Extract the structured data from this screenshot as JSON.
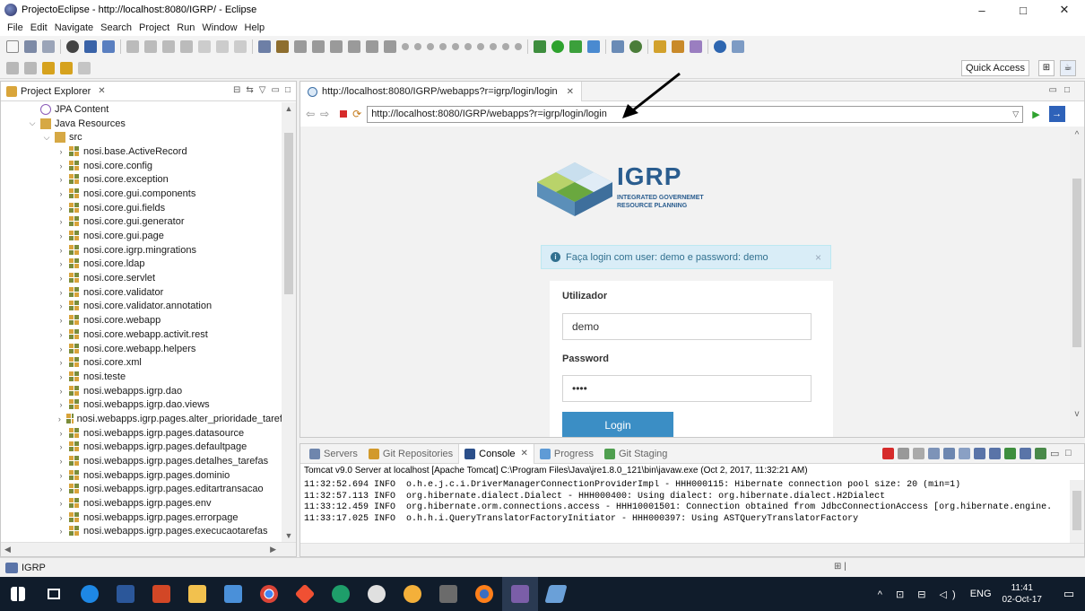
{
  "window": {
    "title": "ProjectoEclipse - http://localhost:8080/IGRP/ - Eclipse",
    "minimize": "–",
    "maximize": "□",
    "close": "✕"
  },
  "menu": [
    "File",
    "Edit",
    "Navigate",
    "Search",
    "Project",
    "Run",
    "Window",
    "Help"
  ],
  "toolbar": {
    "quick_access": "Quick Access"
  },
  "explorer": {
    "title": "Project Explorer",
    "items": [
      {
        "label": "JPA Content",
        "chev": "",
        "indent": 1,
        "icon": "jpa"
      },
      {
        "label": "Java Resources",
        "chev": "v",
        "indent": 1,
        "icon": "folder"
      },
      {
        "label": "src",
        "chev": "v",
        "indent": 2,
        "icon": "folder"
      },
      {
        "label": "nosi.base.ActiveRecord",
        "chev": ">",
        "indent": 3,
        "icon": "pkg"
      },
      {
        "label": "nosi.core.config",
        "chev": ">",
        "indent": 3,
        "icon": "pkg"
      },
      {
        "label": "nosi.core.exception",
        "chev": ">",
        "indent": 3,
        "icon": "pkg"
      },
      {
        "label": "nosi.core.gui.components",
        "chev": ">",
        "indent": 3,
        "icon": "pkg"
      },
      {
        "label": "nosi.core.gui.fields",
        "chev": ">",
        "indent": 3,
        "icon": "pkg"
      },
      {
        "label": "nosi.core.gui.generator",
        "chev": ">",
        "indent": 3,
        "icon": "pkg"
      },
      {
        "label": "nosi.core.gui.page",
        "chev": ">",
        "indent": 3,
        "icon": "pkg"
      },
      {
        "label": "nosi.core.igrp.mingrations",
        "chev": ">",
        "indent": 3,
        "icon": "pkg"
      },
      {
        "label": "nosi.core.ldap",
        "chev": ">",
        "indent": 3,
        "icon": "pkg"
      },
      {
        "label": "nosi.core.servlet",
        "chev": ">",
        "indent": 3,
        "icon": "pkg"
      },
      {
        "label": "nosi.core.validator",
        "chev": ">",
        "indent": 3,
        "icon": "pkg"
      },
      {
        "label": "nosi.core.validator.annotation",
        "chev": ">",
        "indent": 3,
        "icon": "pkg"
      },
      {
        "label": "nosi.core.webapp",
        "chev": ">",
        "indent": 3,
        "icon": "pkg"
      },
      {
        "label": "nosi.core.webapp.activit.rest",
        "chev": ">",
        "indent": 3,
        "icon": "pkg"
      },
      {
        "label": "nosi.core.webapp.helpers",
        "chev": ">",
        "indent": 3,
        "icon": "pkg"
      },
      {
        "label": "nosi.core.xml",
        "chev": ">",
        "indent": 3,
        "icon": "pkg"
      },
      {
        "label": "nosi.teste",
        "chev": ">",
        "indent": 3,
        "icon": "pkg"
      },
      {
        "label": "nosi.webapps.igrp.dao",
        "chev": ">",
        "indent": 3,
        "icon": "pkg"
      },
      {
        "label": "nosi.webapps.igrp.dao.views",
        "chev": ">",
        "indent": 3,
        "icon": "pkg"
      },
      {
        "label": "nosi.webapps.igrp.pages.alter_prioridade_taref",
        "chev": ">",
        "indent": 3,
        "icon": "pkg"
      },
      {
        "label": "nosi.webapps.igrp.pages.datasource",
        "chev": ">",
        "indent": 3,
        "icon": "pkg"
      },
      {
        "label": "nosi.webapps.igrp.pages.defaultpage",
        "chev": ">",
        "indent": 3,
        "icon": "pkg"
      },
      {
        "label": "nosi.webapps.igrp.pages.detalhes_tarefas",
        "chev": ">",
        "indent": 3,
        "icon": "pkg"
      },
      {
        "label": "nosi.webapps.igrp.pages.dominio",
        "chev": ">",
        "indent": 3,
        "icon": "pkg"
      },
      {
        "label": "nosi.webapps.igrp.pages.editartransacao",
        "chev": ">",
        "indent": 3,
        "icon": "pkg"
      },
      {
        "label": "nosi.webapps.igrp.pages.env",
        "chev": ">",
        "indent": 3,
        "icon": "pkg"
      },
      {
        "label": "nosi.webapps.igrp.pages.errorpage",
        "chev": ">",
        "indent": 3,
        "icon": "pkg"
      },
      {
        "label": "nosi.webapps.igrp.pages.execucaotarefas",
        "chev": ">",
        "indent": 3,
        "icon": "pkg"
      }
    ]
  },
  "browser": {
    "tab_title": "http://localhost:8080/IGRP/webapps?r=igrp/login/login",
    "url": "http://localhost:8080/IGRP/webapps?r=igrp/login/login",
    "logo_title": "IGRP",
    "logo_sub1": "INTEGRATED GOVERNEMET",
    "logo_sub2": "RESOURCE PLANNING",
    "alert_text": "Faça login com user: demo e password: demo",
    "alert_close": "×",
    "user_label": "Utilizador",
    "user_value": "demo",
    "password_label": "Password",
    "password_value": "••••",
    "login_button": "Login"
  },
  "console": {
    "tabs": [
      "Servers",
      "Git Repositories",
      "Console",
      "Progress",
      "Git Staging"
    ],
    "active_tab": "Console",
    "description": "Tomcat v9.0 Server at localhost [Apache Tomcat] C:\\Program Files\\Java\\jre1.8.0_121\\bin\\javaw.exe (Oct 2, 2017, 11:32:21 AM)",
    "lines": [
      "11:32:52.694 INFO  o.h.e.j.c.i.DriverManagerConnectionProviderImpl - HHH000115: Hibernate connection pool size: 20 (min=1)",
      "11:32:57.113 INFO  org.hibernate.dialect.Dialect - HHH000400: Using dialect: org.hibernate.dialect.H2Dialect",
      "11:33:12.459 INFO  org.hibernate.orm.connections.access - HHH10001501: Connection obtained from JdbcConnectionAccess [org.hibernate.engine.",
      "11:33:17.025 INFO  o.h.h.i.QueryTranslatorFactoryInitiator - HHH000397: Using ASTQueryTranslatorFactory"
    ]
  },
  "status": {
    "project": "IGRP"
  },
  "taskbar": {
    "language": "ENG",
    "time": "11:41",
    "date": "02-Oct-17"
  }
}
